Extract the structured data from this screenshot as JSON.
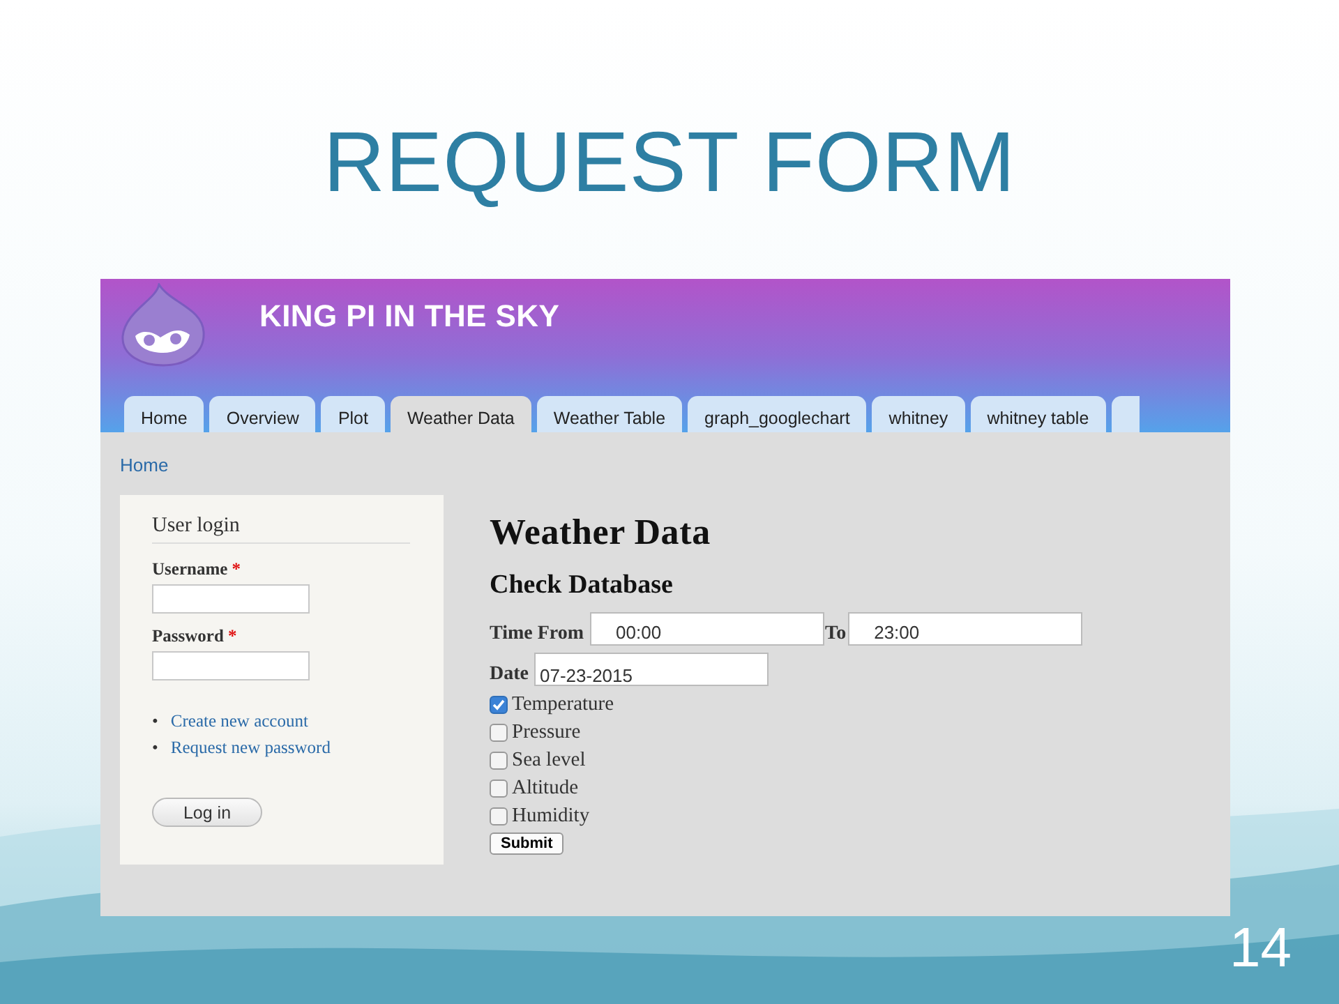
{
  "slide": {
    "title": "REQUEST FORM",
    "page_number": "14"
  },
  "site": {
    "name": "KING PI IN THE SKY"
  },
  "tabs": [
    {
      "label": "Home",
      "selected": false
    },
    {
      "label": "Overview",
      "selected": false
    },
    {
      "label": "Plot",
      "selected": false
    },
    {
      "label": "Weather Data",
      "selected": true
    },
    {
      "label": "Weather Table",
      "selected": false
    },
    {
      "label": "graph_googlechart",
      "selected": false
    },
    {
      "label": "whitney",
      "selected": false
    },
    {
      "label": "whitney table",
      "selected": false
    }
  ],
  "breadcrumb": "Home",
  "login": {
    "title": "User login",
    "fields": [
      {
        "label": "Username",
        "required_mark": "*"
      },
      {
        "label": "Password",
        "required_mark": "*"
      }
    ],
    "links": [
      {
        "bullet": "•",
        "label": "Create new account"
      },
      {
        "bullet": "•",
        "label": "Request new password"
      }
    ],
    "button": "Log in"
  },
  "main": {
    "title": "Weather Data",
    "subtitle": "Check Database",
    "time_from": {
      "label": "Time From",
      "value": "00:00"
    },
    "time_to": {
      "label": "To",
      "value": "23:00"
    },
    "date": {
      "label": "Date",
      "value": "07-23-2015"
    },
    "options": [
      {
        "label": "Temperature",
        "checked": true
      },
      {
        "label": "Pressure",
        "checked": false
      },
      {
        "label": "Sea level",
        "checked": false
      },
      {
        "label": "Altitude",
        "checked": false
      },
      {
        "label": "Humidity",
        "checked": false
      }
    ],
    "submit": "Submit"
  }
}
